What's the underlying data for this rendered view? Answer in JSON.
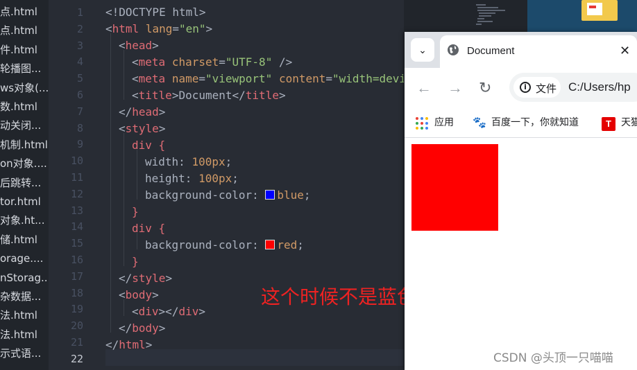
{
  "file_list": [
    "点.html",
    "点.html",
    "件.html",
    "轮播图...",
    "ws对象(...",
    "数.html",
    "动关闭...",
    "机制.html",
    "on对象....",
    "后跳转...",
    "tor.html",
    "对象.ht...",
    "储.html",
    "orage....",
    "nStorag...",
    "杂数据...",
    "法.html",
    "法.html",
    "示式语..."
  ],
  "editor": {
    "line_numbers": [
      "1",
      "2",
      "3",
      "4",
      "5",
      "6",
      "7",
      "8",
      "9",
      "10",
      "11",
      "12",
      "13",
      "14",
      "15",
      "16",
      "17",
      "18",
      "19",
      "20",
      "21",
      "22"
    ],
    "active_line": "22",
    "swatch_colors": {
      "blue": "#0000ff",
      "red": "#ff0000"
    },
    "code": {
      "l1_doctype": "<!DOCTYPE html>",
      "l2_open": "<",
      "l2_tag": "html",
      "l2_attr": "lang",
      "l2_eq": "=",
      "l2_val": "\"en\"",
      "l2_close": ">",
      "l3_open": "<",
      "l3_tag": "head",
      "l3_close": ">",
      "l4_open": "<",
      "l4_tag": "meta",
      "l4_attr": "charset",
      "l4_eq": "=",
      "l4_val": "\"UTF-8\"",
      "l4_close": " />",
      "l5_open": "<",
      "l5_tag": "meta",
      "l5_attr1": "name",
      "l5_eq1": "=",
      "l5_val1": "\"viewport\"",
      "l5_attr2": "content",
      "l5_eq2": "=",
      "l5_val2": "\"width=devi",
      "l6_open": "<",
      "l6_tag": "title",
      "l6_mid": ">Document</",
      "l6_tag2": "title",
      "l6_close": ">",
      "l7_open": "</",
      "l7_tag": "head",
      "l7_close": ">",
      "l8_open": "<",
      "l8_tag": "style",
      "l8_close": ">",
      "l9_sel": "div",
      "l9_brace": " {",
      "l10_prop": "width: ",
      "l10_val": "100px",
      "l10_semi": ";",
      "l11_prop": "height: ",
      "l11_val": "100px",
      "l11_semi": ";",
      "l12_prop": "background-color: ",
      "l12_val": "blue",
      "l12_semi": ";",
      "l13_brace": "}",
      "l14_sel": "div",
      "l14_brace": " {",
      "l15_prop": "background-color: ",
      "l15_val": "red",
      "l15_semi": ";",
      "l16_brace": "}",
      "l17_open": "</",
      "l17_tag": "style",
      "l17_close": ">",
      "l18_open": "<",
      "l18_tag": "body",
      "l18_close": ">",
      "l19_open": "<",
      "l19_tag": "div",
      "l19_mid": "></",
      "l19_tag2": "div",
      "l19_close": ">",
      "l20_open": "</",
      "l20_tag": "body",
      "l20_close": ">",
      "l21_open": "</",
      "l21_tag": "html",
      "l21_close": ">"
    }
  },
  "annotation": "这个时候不是蓝色而是红色",
  "browser": {
    "tab_search_icon": "chevron-down-icon",
    "tab_search_glyph": "⌄",
    "tab_title": "Document",
    "tab_close_glyph": "✕",
    "back_glyph": "←",
    "forward_glyph": "→",
    "reload_glyph": "↻",
    "info_glyph": "i",
    "info_label": "文件",
    "url": "C:/Users/hp",
    "bookmarks": {
      "apps": "应用",
      "baidu": "百度一下，你就知道",
      "tmall": "天猫"
    },
    "baidu_glyph": "🐾",
    "tmall_glyph": "T",
    "rendered_div_color": "#ff0000"
  },
  "watermark": "CSDN @头顶一只喵喵"
}
